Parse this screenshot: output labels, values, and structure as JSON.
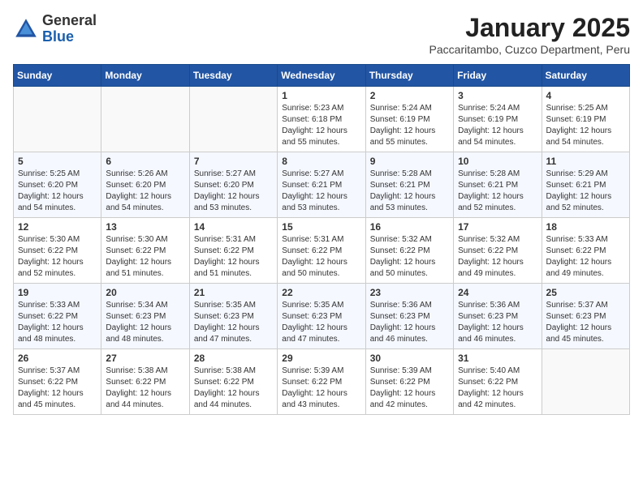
{
  "header": {
    "logo_general": "General",
    "logo_blue": "Blue",
    "month_title": "January 2025",
    "location": "Paccaritambo, Cuzco Department, Peru"
  },
  "days_of_week": [
    "Sunday",
    "Monday",
    "Tuesday",
    "Wednesday",
    "Thursday",
    "Friday",
    "Saturday"
  ],
  "weeks": [
    [
      {
        "day": "",
        "info": ""
      },
      {
        "day": "",
        "info": ""
      },
      {
        "day": "",
        "info": ""
      },
      {
        "day": "1",
        "info": "Sunrise: 5:23 AM\nSunset: 6:18 PM\nDaylight: 12 hours\nand 55 minutes."
      },
      {
        "day": "2",
        "info": "Sunrise: 5:24 AM\nSunset: 6:19 PM\nDaylight: 12 hours\nand 55 minutes."
      },
      {
        "day": "3",
        "info": "Sunrise: 5:24 AM\nSunset: 6:19 PM\nDaylight: 12 hours\nand 54 minutes."
      },
      {
        "day": "4",
        "info": "Sunrise: 5:25 AM\nSunset: 6:19 PM\nDaylight: 12 hours\nand 54 minutes."
      }
    ],
    [
      {
        "day": "5",
        "info": "Sunrise: 5:25 AM\nSunset: 6:20 PM\nDaylight: 12 hours\nand 54 minutes."
      },
      {
        "day": "6",
        "info": "Sunrise: 5:26 AM\nSunset: 6:20 PM\nDaylight: 12 hours\nand 54 minutes."
      },
      {
        "day": "7",
        "info": "Sunrise: 5:27 AM\nSunset: 6:20 PM\nDaylight: 12 hours\nand 53 minutes."
      },
      {
        "day": "8",
        "info": "Sunrise: 5:27 AM\nSunset: 6:21 PM\nDaylight: 12 hours\nand 53 minutes."
      },
      {
        "day": "9",
        "info": "Sunrise: 5:28 AM\nSunset: 6:21 PM\nDaylight: 12 hours\nand 53 minutes."
      },
      {
        "day": "10",
        "info": "Sunrise: 5:28 AM\nSunset: 6:21 PM\nDaylight: 12 hours\nand 52 minutes."
      },
      {
        "day": "11",
        "info": "Sunrise: 5:29 AM\nSunset: 6:21 PM\nDaylight: 12 hours\nand 52 minutes."
      }
    ],
    [
      {
        "day": "12",
        "info": "Sunrise: 5:30 AM\nSunset: 6:22 PM\nDaylight: 12 hours\nand 52 minutes."
      },
      {
        "day": "13",
        "info": "Sunrise: 5:30 AM\nSunset: 6:22 PM\nDaylight: 12 hours\nand 51 minutes."
      },
      {
        "day": "14",
        "info": "Sunrise: 5:31 AM\nSunset: 6:22 PM\nDaylight: 12 hours\nand 51 minutes."
      },
      {
        "day": "15",
        "info": "Sunrise: 5:31 AM\nSunset: 6:22 PM\nDaylight: 12 hours\nand 50 minutes."
      },
      {
        "day": "16",
        "info": "Sunrise: 5:32 AM\nSunset: 6:22 PM\nDaylight: 12 hours\nand 50 minutes."
      },
      {
        "day": "17",
        "info": "Sunrise: 5:32 AM\nSunset: 6:22 PM\nDaylight: 12 hours\nand 49 minutes."
      },
      {
        "day": "18",
        "info": "Sunrise: 5:33 AM\nSunset: 6:22 PM\nDaylight: 12 hours\nand 49 minutes."
      }
    ],
    [
      {
        "day": "19",
        "info": "Sunrise: 5:33 AM\nSunset: 6:22 PM\nDaylight: 12 hours\nand 48 minutes."
      },
      {
        "day": "20",
        "info": "Sunrise: 5:34 AM\nSunset: 6:23 PM\nDaylight: 12 hours\nand 48 minutes."
      },
      {
        "day": "21",
        "info": "Sunrise: 5:35 AM\nSunset: 6:23 PM\nDaylight: 12 hours\nand 47 minutes."
      },
      {
        "day": "22",
        "info": "Sunrise: 5:35 AM\nSunset: 6:23 PM\nDaylight: 12 hours\nand 47 minutes."
      },
      {
        "day": "23",
        "info": "Sunrise: 5:36 AM\nSunset: 6:23 PM\nDaylight: 12 hours\nand 46 minutes."
      },
      {
        "day": "24",
        "info": "Sunrise: 5:36 AM\nSunset: 6:23 PM\nDaylight: 12 hours\nand 46 minutes."
      },
      {
        "day": "25",
        "info": "Sunrise: 5:37 AM\nSunset: 6:23 PM\nDaylight: 12 hours\nand 45 minutes."
      }
    ],
    [
      {
        "day": "26",
        "info": "Sunrise: 5:37 AM\nSunset: 6:22 PM\nDaylight: 12 hours\nand 45 minutes."
      },
      {
        "day": "27",
        "info": "Sunrise: 5:38 AM\nSunset: 6:22 PM\nDaylight: 12 hours\nand 44 minutes."
      },
      {
        "day": "28",
        "info": "Sunrise: 5:38 AM\nSunset: 6:22 PM\nDaylight: 12 hours\nand 44 minutes."
      },
      {
        "day": "29",
        "info": "Sunrise: 5:39 AM\nSunset: 6:22 PM\nDaylight: 12 hours\nand 43 minutes."
      },
      {
        "day": "30",
        "info": "Sunrise: 5:39 AM\nSunset: 6:22 PM\nDaylight: 12 hours\nand 42 minutes."
      },
      {
        "day": "31",
        "info": "Sunrise: 5:40 AM\nSunset: 6:22 PM\nDaylight: 12 hours\nand 42 minutes."
      },
      {
        "day": "",
        "info": ""
      }
    ]
  ]
}
